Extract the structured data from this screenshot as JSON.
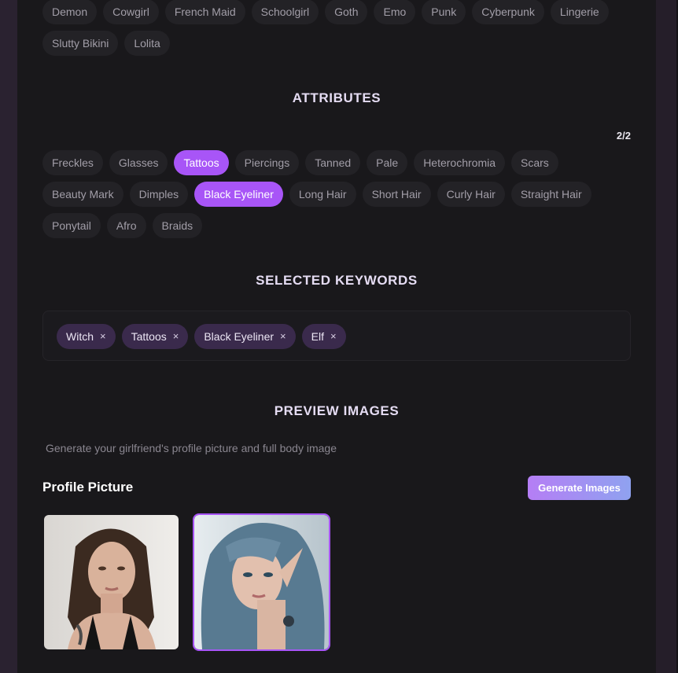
{
  "styles_row1": [
    "Demon",
    "Cowgirl",
    "French Maid",
    "Schoolgirl",
    "Goth",
    "Emo",
    "Punk",
    "Cyberpunk",
    "Lingerie"
  ],
  "styles_row2": [
    "Slutty Bikini",
    "Lolita"
  ],
  "attributes": {
    "title": "ATTRIBUTES",
    "counter": "2/2",
    "row1": [
      "Freckles",
      "Glasses",
      "Tattoos",
      "Piercings",
      "Tanned",
      "Pale",
      "Heterochromia",
      "Scars"
    ],
    "row2": [
      "Beauty Mark",
      "Dimples",
      "Black Eyeliner",
      "Long Hair",
      "Short Hair",
      "Curly Hair",
      "Straight Hair"
    ],
    "row3": [
      "Ponytail",
      "Afro",
      "Braids"
    ],
    "selected": [
      "Tattoos",
      "Black Eyeliner"
    ]
  },
  "selected_keywords": {
    "title": "SELECTED KEYWORDS",
    "items": [
      "Witch",
      "Tattoos",
      "Black Eyeliner",
      "Elf"
    ],
    "remove_glyph": "×"
  },
  "preview": {
    "title": "PREVIEW IMAGES",
    "description": "Generate your girlfriend's profile picture and full body image",
    "profile_title": "Profile Picture",
    "generate_label": "Generate Images",
    "selected_index": 1
  },
  "colors": {
    "accent": "#a855f7",
    "chip_bg": "#232226",
    "keyword_bg": "#3a2a4c",
    "panel_bg": "#19181b"
  }
}
